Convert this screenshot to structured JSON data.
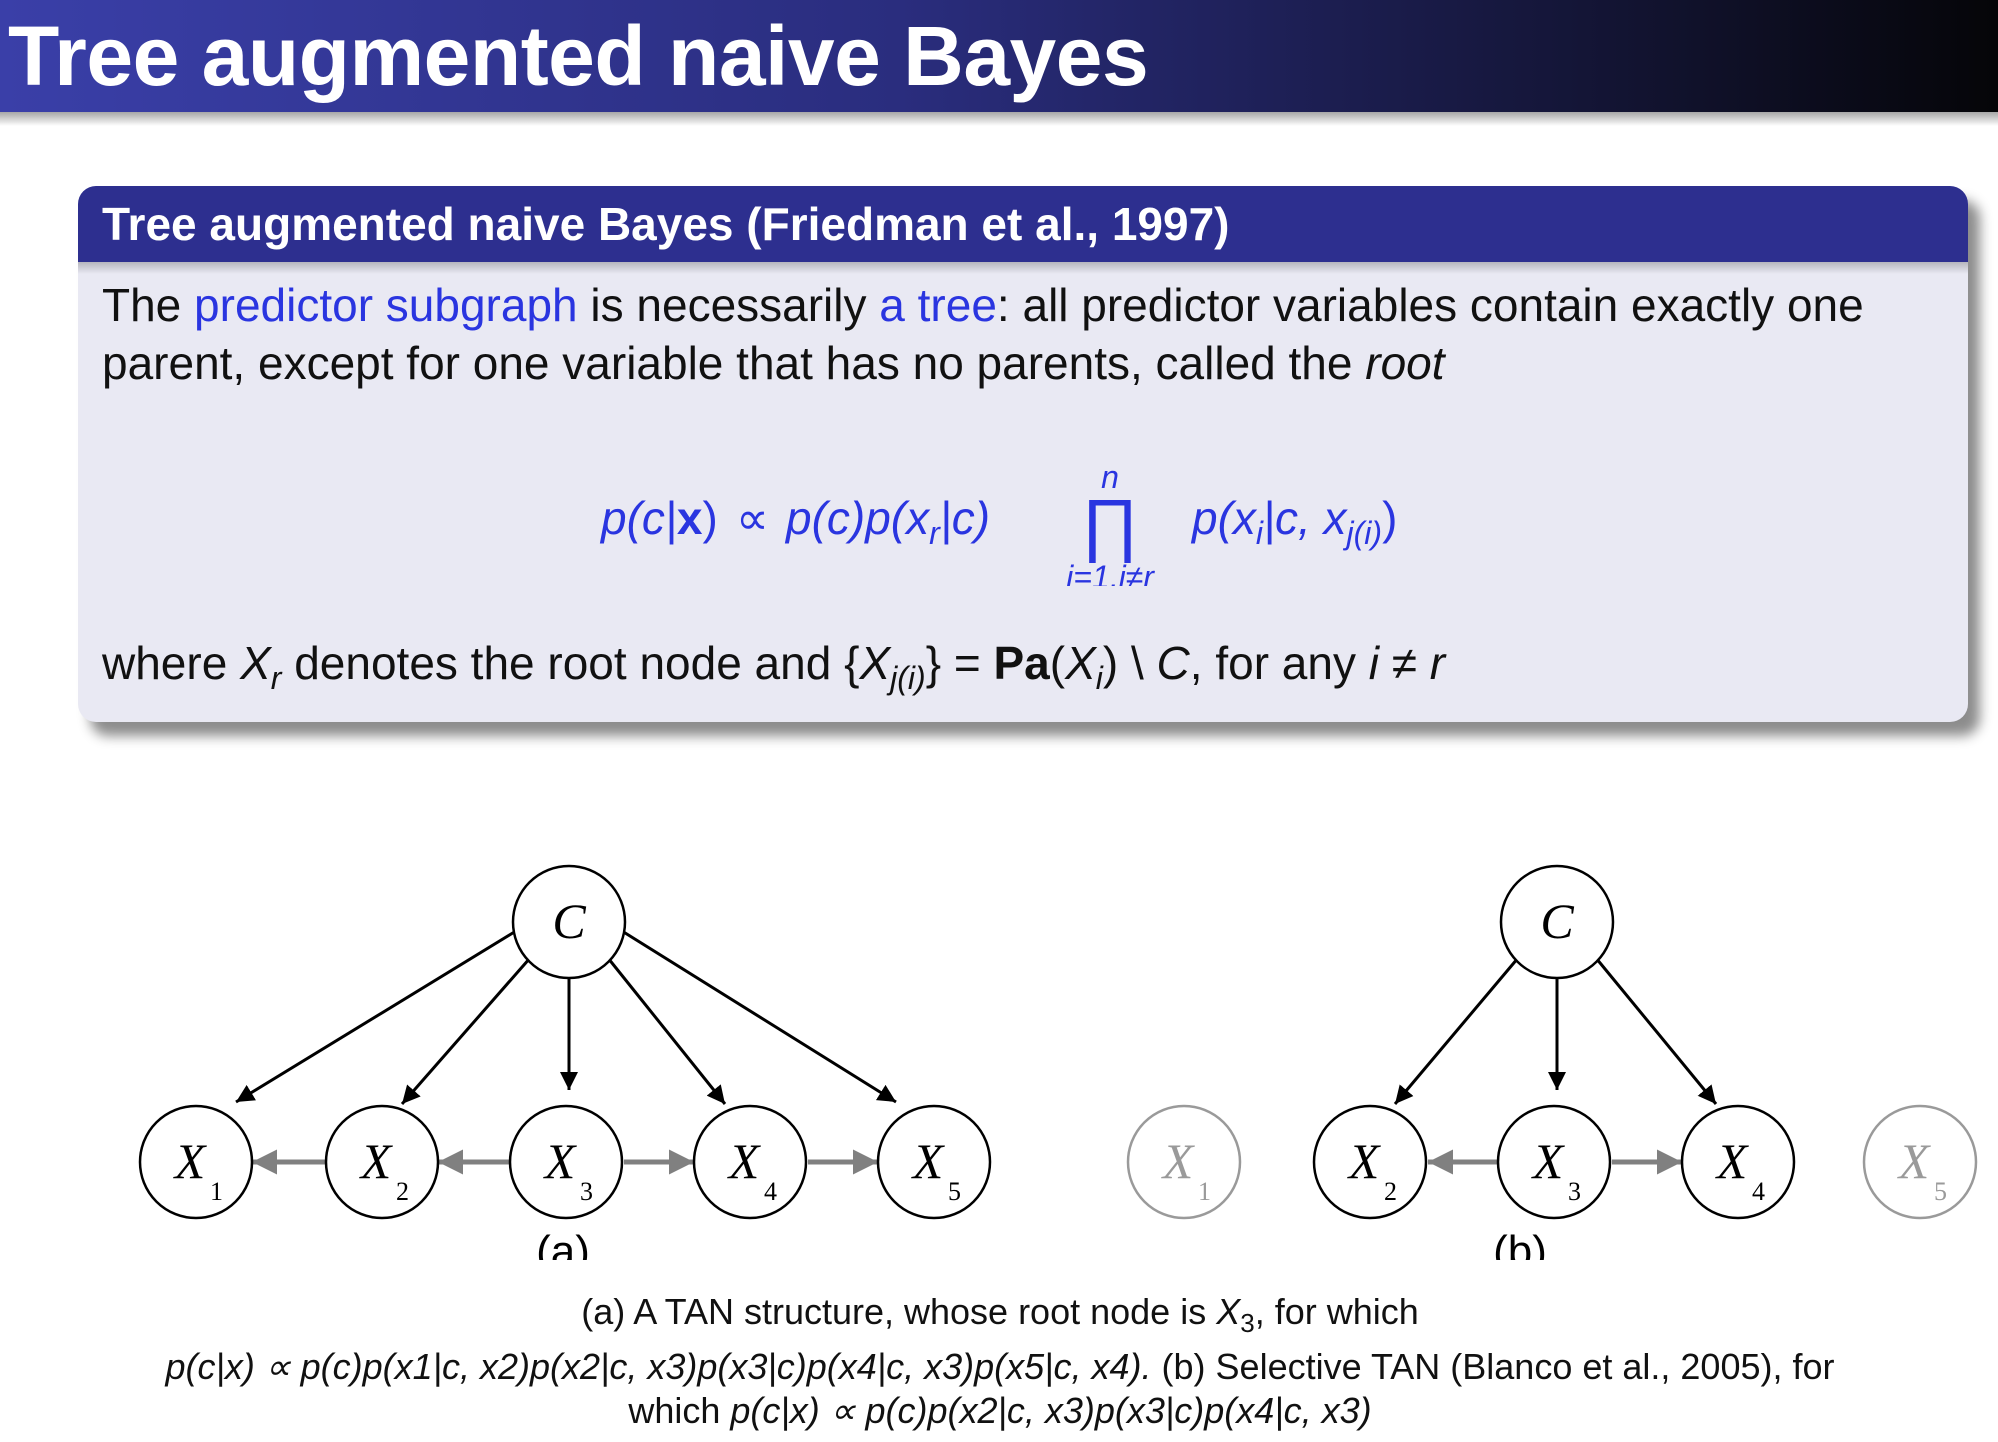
{
  "slide": {
    "title": "Tree augmented naive Bayes"
  },
  "block": {
    "title": "Tree augmented naive Bayes (Friedman et al., 1997)",
    "intro": {
      "t1": "The ",
      "hl1": "predictor subgraph",
      "t2": " is necessarily ",
      "hl2": "a tree",
      "t3": ": all predictor variables contain exactly one parent, except for one variable that has no parents, called the ",
      "root_word": "root"
    },
    "formula": {
      "lhs": "p(c|",
      "bold_x": "x",
      "lhs_close": ")",
      "prop": "∝",
      "prior": "p(c)p(x",
      "r_sub": "r",
      "prior_close": "|c)",
      "prod_symbol": "∏",
      "prod_upper": "n",
      "prod_lower": "i=1,i≠r",
      "term": "p(x",
      "i_sub": "i",
      "term_mid": "|c, x",
      "j_sub": "j(i)",
      "term_close": ")"
    },
    "where": {
      "t1": "where ",
      "x": "X",
      "r": "r",
      "t2": " denotes the root node and {",
      "j": "j(i)",
      "t3": "} = ",
      "pa": "Pa",
      "t4": "(",
      "i": "i",
      "t5": ") \\ ",
      "c": "C",
      "t6": ", for any ",
      "ineq_i": "i",
      "ne": " ≠ ",
      "ineq_r": "r"
    }
  },
  "diagram_a": {
    "label": "(a)",
    "nodes": [
      {
        "id": "C",
        "label": "C",
        "sub": ""
      },
      {
        "id": "X1",
        "label": "X",
        "sub": "1"
      },
      {
        "id": "X2",
        "label": "X",
        "sub": "2"
      },
      {
        "id": "X3",
        "label": "X",
        "sub": "3"
      },
      {
        "id": "X4",
        "label": "X",
        "sub": "4"
      },
      {
        "id": "X5",
        "label": "X",
        "sub": "5"
      }
    ]
  },
  "diagram_b": {
    "label": "(b)",
    "nodes": [
      {
        "id": "C",
        "label": "C",
        "sub": ""
      },
      {
        "id": "X1",
        "label": "X",
        "sub": "1"
      },
      {
        "id": "X2",
        "label": "X",
        "sub": "2"
      },
      {
        "id": "X3",
        "label": "X",
        "sub": "3"
      },
      {
        "id": "X4",
        "label": "X",
        "sub": "4"
      },
      {
        "id": "X5",
        "label": "X",
        "sub": "5"
      }
    ]
  },
  "caption": {
    "line1_a": "(a) A TAN structure, whose root node is ",
    "line1_x": "X",
    "line1_sub": "3",
    "line1_b": ", for which",
    "line2_formula": "p(c|x) ∝ p(c)p(x1|c, x2)p(x2|c, x3)p(x3|c)p(x4|c, x3)p(x5|c, x4).",
    "line2_text": " (b) Selective TAN (Blanco et al., 2005), for",
    "line3_text": "which ",
    "line3_formula": "p(c|x) ∝ p(c)p(x2|c, x3)p(x3|c)p(x4|c, x3)"
  },
  "colors": {
    "title_bar": "#2d2f8f",
    "block_bg": "#e9e9f3",
    "highlight": "#2a35e0",
    "faded_node": "#9a9a9a",
    "tree_arrow": "#808080"
  }
}
